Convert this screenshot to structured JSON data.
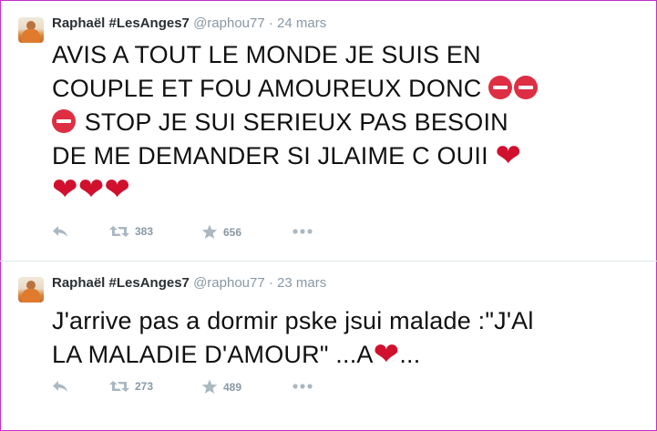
{
  "tweets": [
    {
      "name": "Raphaël #LesAnges7",
      "handle": "@raphou77",
      "separator": "·",
      "date": "24 mars",
      "text": {
        "line1": "AVIS A TOUT LE MONDE JE SUIS EN",
        "line2": "COUPLE ET FOU AMOUREUX DONC ",
        "line3": " STOP JE SUI SERIEUX PAS BESOIN",
        "line4": "DE ME DEMANDER SI JLAIME C OUII "
      },
      "retweets": "383",
      "favorites": "656"
    },
    {
      "name": "Raphaël #LesAnges7",
      "handle": "@raphou77",
      "separator": "·",
      "date": "23 mars",
      "text": {
        "line1": "J'arrive pas a dormir pske jsui malade :\"J'Al",
        "line2a": "LA MALADIE D'AMOUR\" ...A",
        "line2b": "..."
      },
      "retweets": "273",
      "favorites": "489"
    }
  ],
  "icons": {
    "reply": "reply-icon",
    "retweet": "retweet-icon",
    "favorite": "star-icon",
    "more": "more-icon",
    "stop": "no-entry-emoji",
    "heart": "red-heart-emoji"
  },
  "emoji": {
    "heart": "❤"
  },
  "colors": {
    "frame": "#c42fc7",
    "heart": "#d0102d",
    "stop": "#dd2e44",
    "meta": "#8899a6"
  }
}
